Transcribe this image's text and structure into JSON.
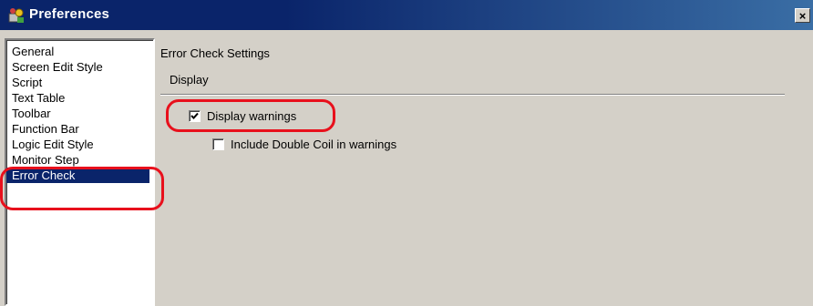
{
  "window": {
    "title": "Preferences",
    "close_label": "×"
  },
  "sidebar": {
    "items": [
      {
        "label": "General",
        "selected": false
      },
      {
        "label": "Screen Edit Style",
        "selected": false
      },
      {
        "label": "Script",
        "selected": false
      },
      {
        "label": "Text Table",
        "selected": false
      },
      {
        "label": "Toolbar",
        "selected": false
      },
      {
        "label": "Function Bar",
        "selected": false
      },
      {
        "label": "Logic Edit Style",
        "selected": false
      },
      {
        "label": "Monitor Step",
        "selected": false
      },
      {
        "label": "Error Check",
        "selected": true
      }
    ]
  },
  "main": {
    "title": "Error Check Settings",
    "section": "Display",
    "options": {
      "display_warnings": {
        "label": "Display warnings",
        "checked": true
      },
      "include_double_coil": {
        "label": "Include Double Coil in warnings",
        "checked": false
      }
    }
  },
  "colors": {
    "titlebar": "#0a246a",
    "selection": "#0a246a",
    "highlight_annotation": "#e8101c",
    "dialog_background": "#d4d0c8"
  }
}
